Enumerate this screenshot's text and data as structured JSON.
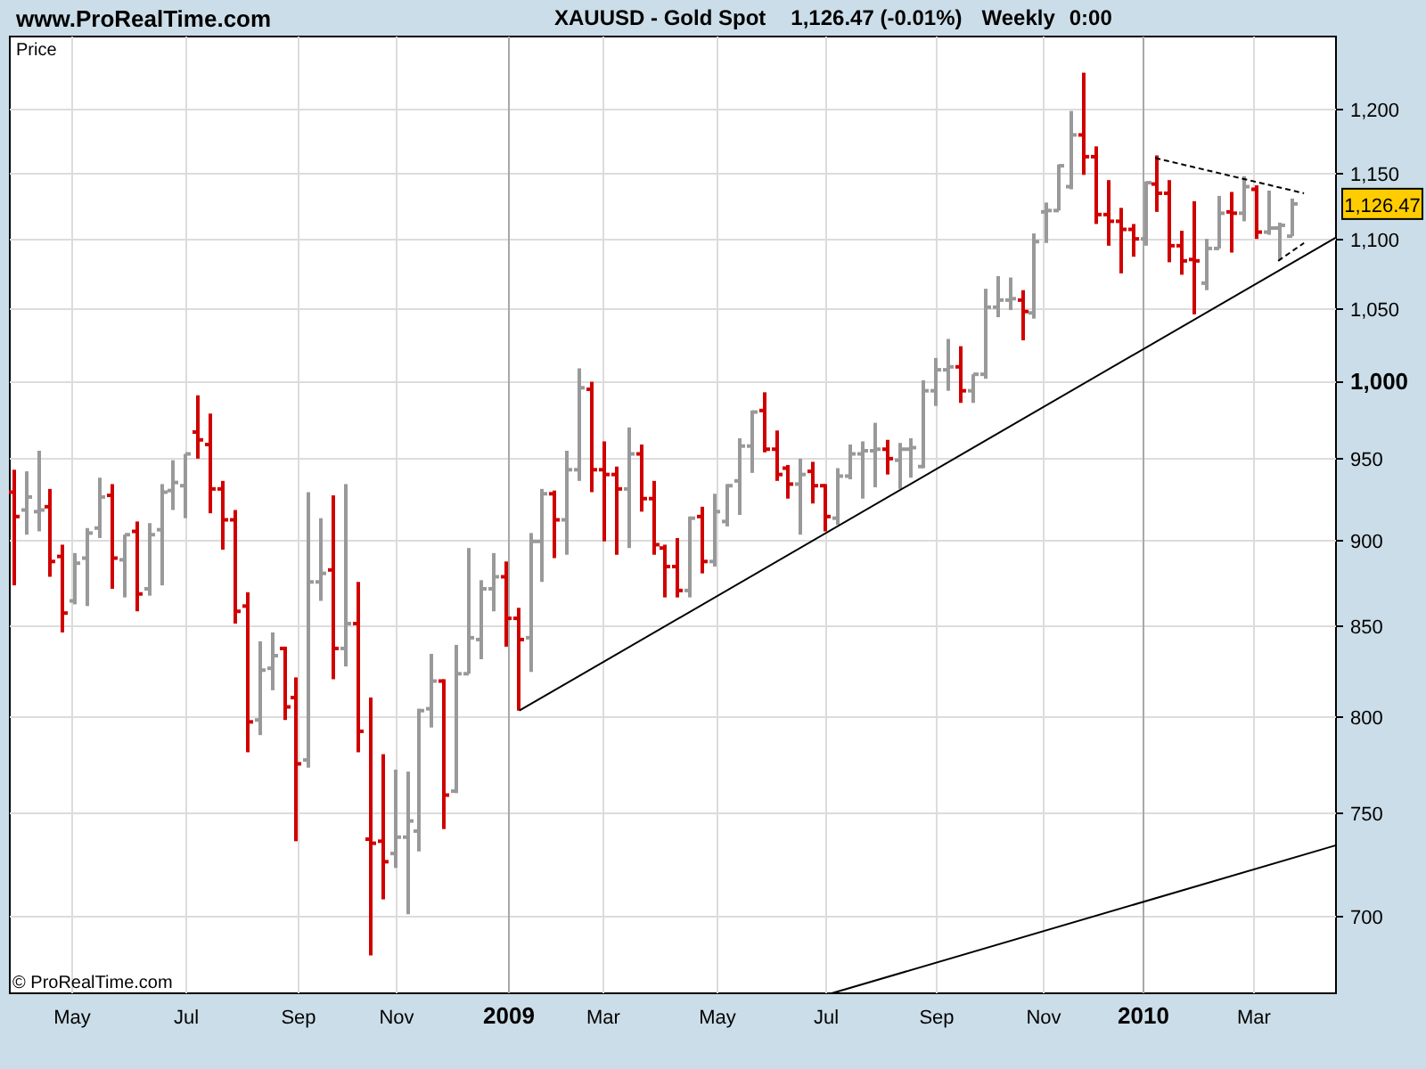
{
  "header": {
    "site": "www.ProRealTime.com",
    "instrument": "XAUUSD - Gold Spot",
    "quote": "1,126.47 (-0.01%)",
    "period": "Weekly",
    "time": "0:00"
  },
  "chart": {
    "axis_title": "Price",
    "copyright": "© ProRealTime.com",
    "price_tag": "1,126.47",
    "y_axis_labels": [
      {
        "text": "1,200",
        "bold": false
      },
      {
        "text": "1,150",
        "bold": false
      },
      {
        "text": "1,100",
        "bold": false
      },
      {
        "text": "1,050",
        "bold": false
      },
      {
        "text": "1,000",
        "bold": true
      },
      {
        "text": "950",
        "bold": false
      },
      {
        "text": "900",
        "bold": false
      },
      {
        "text": "850",
        "bold": false
      },
      {
        "text": "800",
        "bold": false
      },
      {
        "text": "750",
        "bold": false
      },
      {
        "text": "700",
        "bold": false
      }
    ],
    "x_axis_labels": [
      {
        "text": "May",
        "bold": false
      },
      {
        "text": "Jul",
        "bold": false
      },
      {
        "text": "Sep",
        "bold": false
      },
      {
        "text": "Nov",
        "bold": false
      },
      {
        "text": "2009",
        "bold": true
      },
      {
        "text": "Mar",
        "bold": false
      },
      {
        "text": "May",
        "bold": false
      },
      {
        "text": "Jul",
        "bold": false
      },
      {
        "text": "Sep",
        "bold": false
      },
      {
        "text": "Nov",
        "bold": false
      },
      {
        "text": "2010",
        "bold": true
      },
      {
        "text": "Mar",
        "bold": false
      }
    ]
  }
}
